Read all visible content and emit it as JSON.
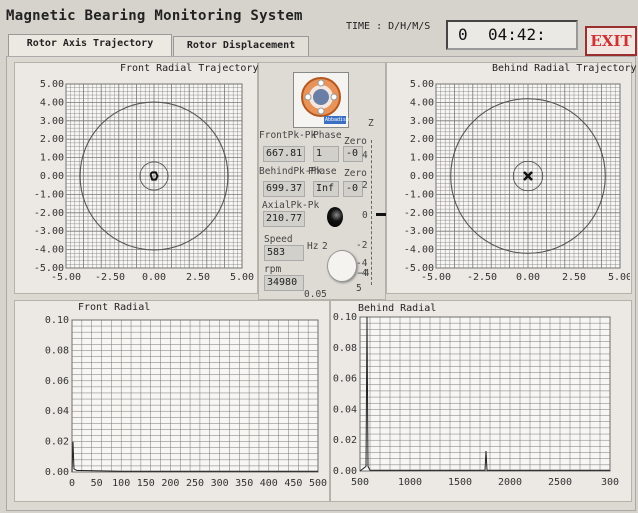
{
  "app_title": "Magnetic Bearing Monitoring System",
  "time_label": "TIME : D/H/M/S",
  "time_days": "0",
  "time_clock": "04:42:",
  "exit_label": "EXIT",
  "tabs": [
    {
      "label": "Rotor Axis Trajectory",
      "active": true
    },
    {
      "label": "Rotor Displacement",
      "active": false
    }
  ],
  "front_traj": {
    "title": "Front Radial Trajectory"
  },
  "behind_traj": {
    "title": "Behind Radial Trajectory"
  },
  "traj_ticks": {
    "y": [
      "5.00",
      "4.00",
      "3.00",
      "2.00",
      "1.00",
      "0.00",
      "-1.00",
      "-2.00",
      "-3.00",
      "-4.00",
      "-5.00"
    ],
    "x": [
      "-5.00",
      "-2.50",
      "0.00",
      "2.50",
      "5.00"
    ]
  },
  "logo_text": "Abbadise",
  "center": {
    "front_pkpk_label": "FrontPk-Pk",
    "front_pkpk_value": "667.81",
    "phase_label": "Phase",
    "front_phase_value": "1",
    "zero_label": "Zero",
    "front_zero_value": "-0",
    "behind_pkpk_label": "BehindPk-Pk",
    "behind_pkpk_value": "699.37",
    "behind_phase_label": "Phase",
    "behind_phase_value": "Inf",
    "behind_zero_label": "Zero",
    "behind_zero_value": "-0",
    "axial_label": "AxialPk-Pk",
    "axial_value": "210.77",
    "speed_label": "Speed",
    "speed_value": "583",
    "hz_label": "Hz",
    "rpm_label": "rpm",
    "rpm_value": "34980",
    "knob_value": "0.05",
    "z_axis_label": "Z",
    "z_scale": [
      "4",
      "2",
      "0",
      "-2",
      "-4"
    ],
    "knob_scale": [
      "2",
      "-4",
      "-4",
      "5"
    ]
  },
  "front_radial": {
    "title": "Front Radial"
  },
  "behind_radial": {
    "title": "Behind Radial"
  },
  "spectrum_y_ticks": [
    "0.10",
    "0.08",
    "0.06",
    "0.04",
    "0.02",
    "0.00"
  ],
  "front_x_ticks": [
    "0",
    "50",
    "100",
    "150",
    "200",
    "250",
    "300",
    "350",
    "400",
    "450",
    "500"
  ],
  "behind_x_ticks": [
    "500",
    "1000",
    "1500",
    "2000",
    "2500",
    "300"
  ],
  "colors": {
    "panel_bg": "#ece9e4",
    "exit": "#cc3333",
    "grid": "#555555"
  },
  "chart_data": [
    {
      "type": "scatter",
      "title": "Front Radial Trajectory",
      "x": [
        -0.2,
        -0.1,
        0.1,
        0.2,
        0.1,
        -0.1,
        -0.2
      ],
      "y": [
        0.1,
        0.2,
        0.2,
        0.0,
        -0.2,
        -0.2,
        0.1
      ],
      "xlim": [
        -5,
        5
      ],
      "ylim": [
        -5,
        5
      ]
    },
    {
      "type": "scatter",
      "title": "Behind Radial Trajectory",
      "x": [
        0.0
      ],
      "y": [
        0.0
      ],
      "xlim": [
        -5,
        5
      ],
      "ylim": [
        -5,
        5
      ]
    },
    {
      "type": "line",
      "title": "Front Radial",
      "xlim": [
        0,
        500
      ],
      "ylim": [
        0,
        0.1
      ],
      "x": [
        0,
        2,
        4,
        10,
        20,
        100,
        200,
        300,
        400,
        500
      ],
      "y": [
        0.0,
        0.02,
        0.002,
        0.001,
        0.001,
        0.0005,
        0.0005,
        0.0005,
        0.0005,
        0.0005
      ]
    },
    {
      "type": "line",
      "title": "Behind Radial",
      "xlim": [
        500,
        3000
      ],
      "ylim": [
        0,
        0.1
      ],
      "x": [
        500,
        560,
        570,
        580,
        600,
        800,
        1000,
        1700,
        1750,
        1760,
        1770,
        2000,
        3000
      ],
      "y": [
        0.0,
        0.003,
        0.1,
        0.003,
        0.0005,
        0.0005,
        0.0005,
        0.0005,
        0.0005,
        0.013,
        0.0005,
        0.0005,
        0.0005
      ]
    }
  ]
}
